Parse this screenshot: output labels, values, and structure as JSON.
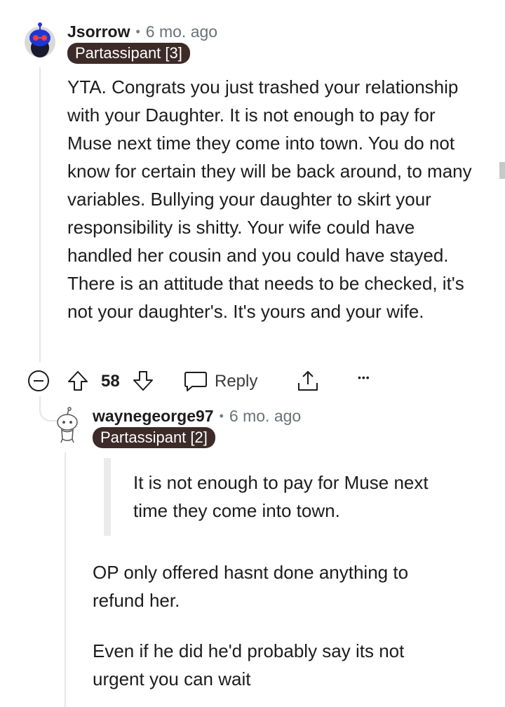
{
  "comment1": {
    "username": "Jsorrow",
    "separator": "•",
    "time": "6 mo. ago",
    "flair": "Partassipant [3]",
    "body": "YTA. Congrats you just trashed your relationship with your Daughter. It is not enough to pay for Muse next time they come into town. You do not know for certain they will be back around, to many variables. Bullying your daughter to skirt your responsibility is shitty. Your wife could have handled her cousin and you could have stayed. There is an attitude that needs to be checked, it's not your daughter's. It's yours and your wife.",
    "actions": {
      "vote_count": "58",
      "reply_label": "Reply",
      "more_label": "•••"
    }
  },
  "comment2": {
    "username": "waynegeorge97",
    "separator": "•",
    "time": "6 mo. ago",
    "flair": "Partassipant [2]",
    "quote": "It is not enough to pay for Muse next time they come into town.",
    "paragraph1": "OP only offered hasnt done anything to refund her.",
    "paragraph2": "Even if he did he'd probably say its not urgent you can wait"
  },
  "colors": {
    "flair_bg": "#3d2b28",
    "avatar_blue": "#1f35d6",
    "thread_line": "#e6e6e6"
  }
}
